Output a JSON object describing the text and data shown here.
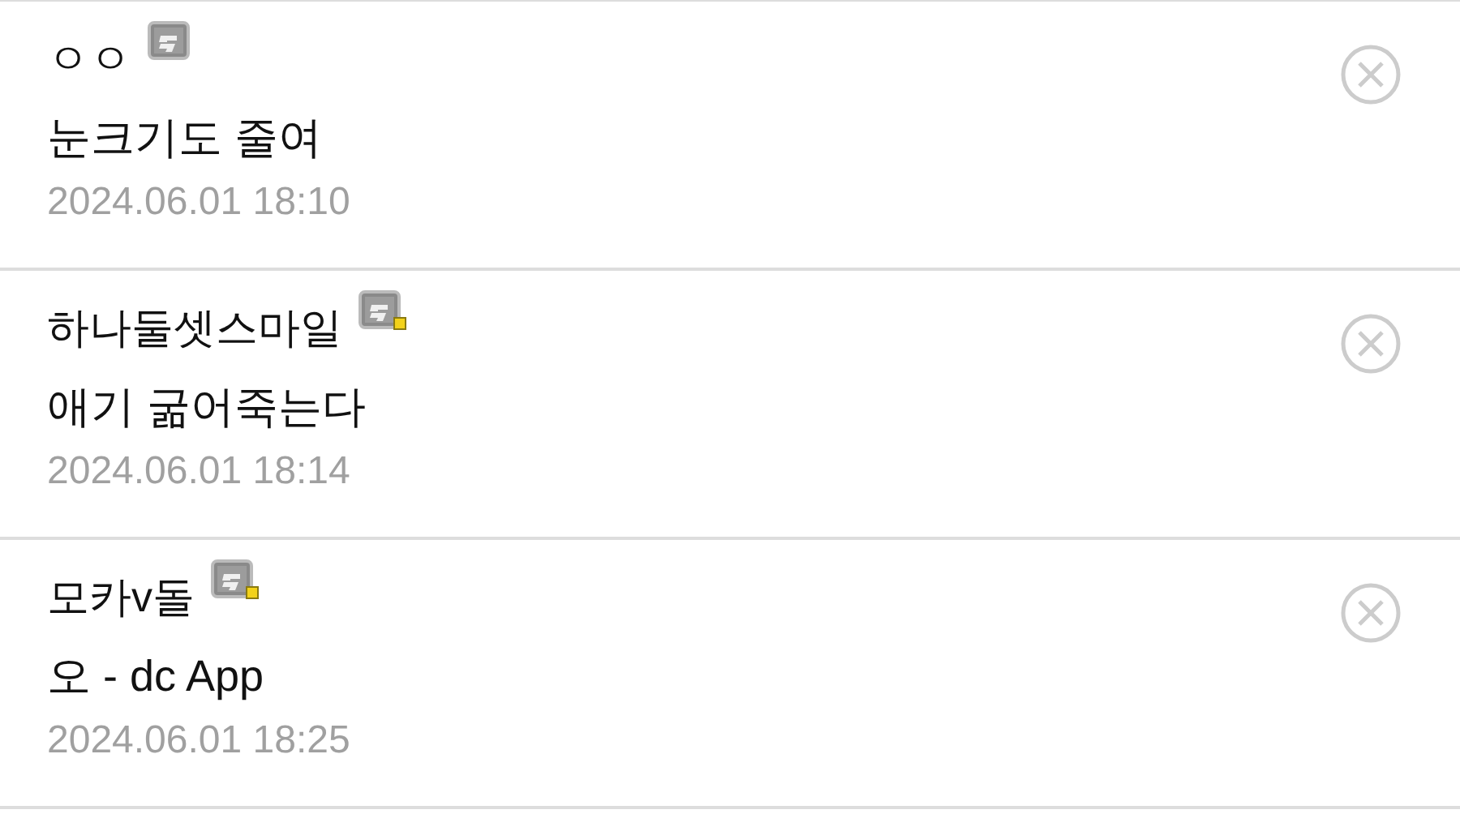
{
  "comments": [
    {
      "author": "ㅇㅇ",
      "badge_dot": false,
      "text": "눈크기도 줄여",
      "date": "2024.06.01 18:10"
    },
    {
      "author": "하나둘셋스마일",
      "badge_dot": true,
      "text": "애기 굶어죽는다",
      "date": "2024.06.01 18:14"
    },
    {
      "author": "모카v돌",
      "badge_dot": true,
      "text": "오 - dc App",
      "date": "2024.06.01 18:25"
    }
  ]
}
